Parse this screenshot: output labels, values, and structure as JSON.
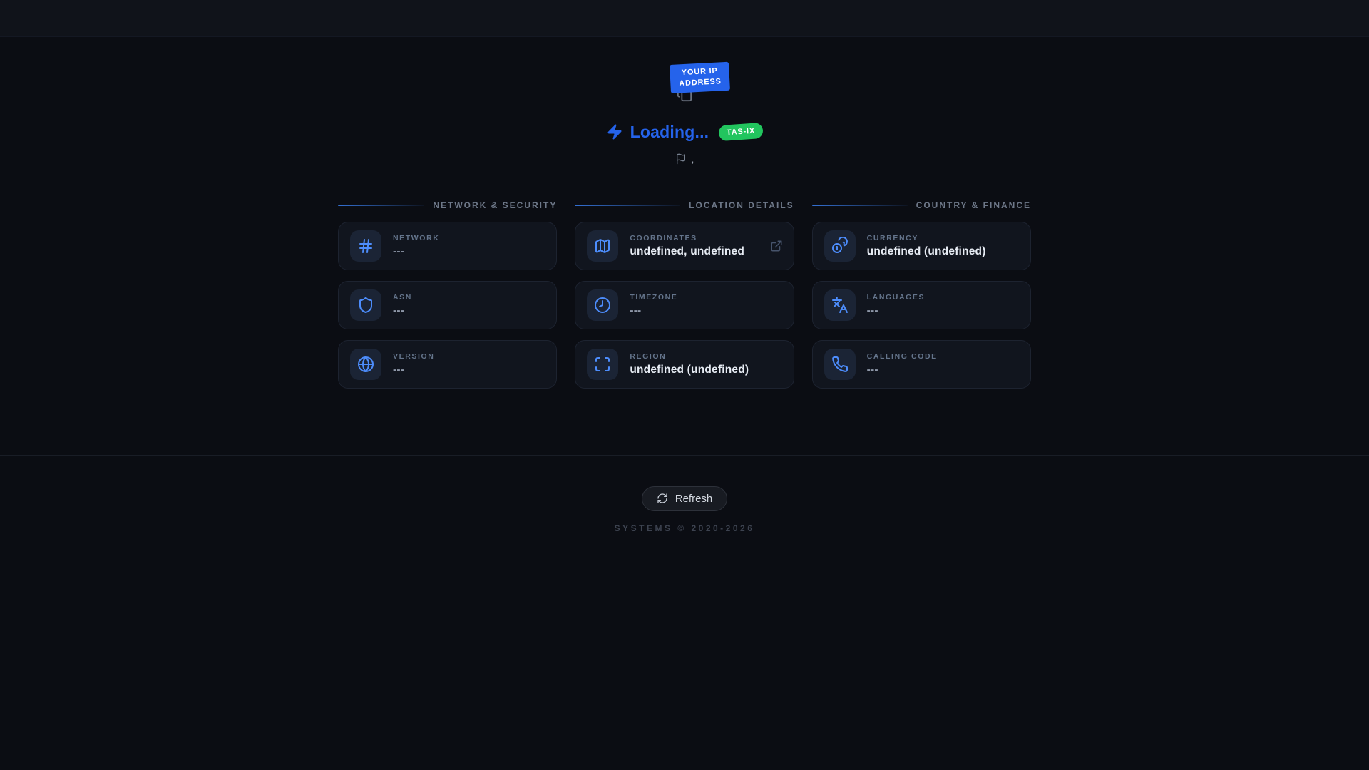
{
  "accent_colors": {
    "primary_blue": "#2563eb",
    "success_green": "#22c55e"
  },
  "hero": {
    "badge_line1": "YOUR IP",
    "badge_line2": "ADDRESS",
    "loading_label": "Loading...",
    "network_badge": "TAS-IX",
    "location_text": ","
  },
  "sections": [
    {
      "title": "NETWORK & SECURITY",
      "cards": [
        {
          "icon": "hash-icon",
          "label": "NETWORK",
          "value": "---"
        },
        {
          "icon": "shield-icon",
          "label": "ASN",
          "value": "---"
        },
        {
          "icon": "globe-icon",
          "label": "VERSION",
          "value": "---"
        }
      ]
    },
    {
      "title": "LOCATION DETAILS",
      "cards": [
        {
          "icon": "map-icon",
          "label": "COORDINATES",
          "value": "undefined, undefined",
          "has_external_link": true
        },
        {
          "icon": "clock-icon",
          "label": "TIMEZONE",
          "value": "---"
        },
        {
          "icon": "maximize-icon",
          "label": "REGION",
          "value": "undefined (undefined)"
        }
      ]
    },
    {
      "title": "COUNTRY & FINANCE",
      "cards": [
        {
          "icon": "coins-icon",
          "label": "CURRENCY",
          "value": "undefined (undefined)"
        },
        {
          "icon": "languages-icon",
          "label": "LANGUAGES",
          "value": "---"
        },
        {
          "icon": "phone-icon",
          "label": "CALLING CODE",
          "value": "---"
        }
      ]
    }
  ],
  "footer": {
    "refresh_label": "Refresh",
    "copyright": "SYSTEMS © 2020-2026"
  }
}
